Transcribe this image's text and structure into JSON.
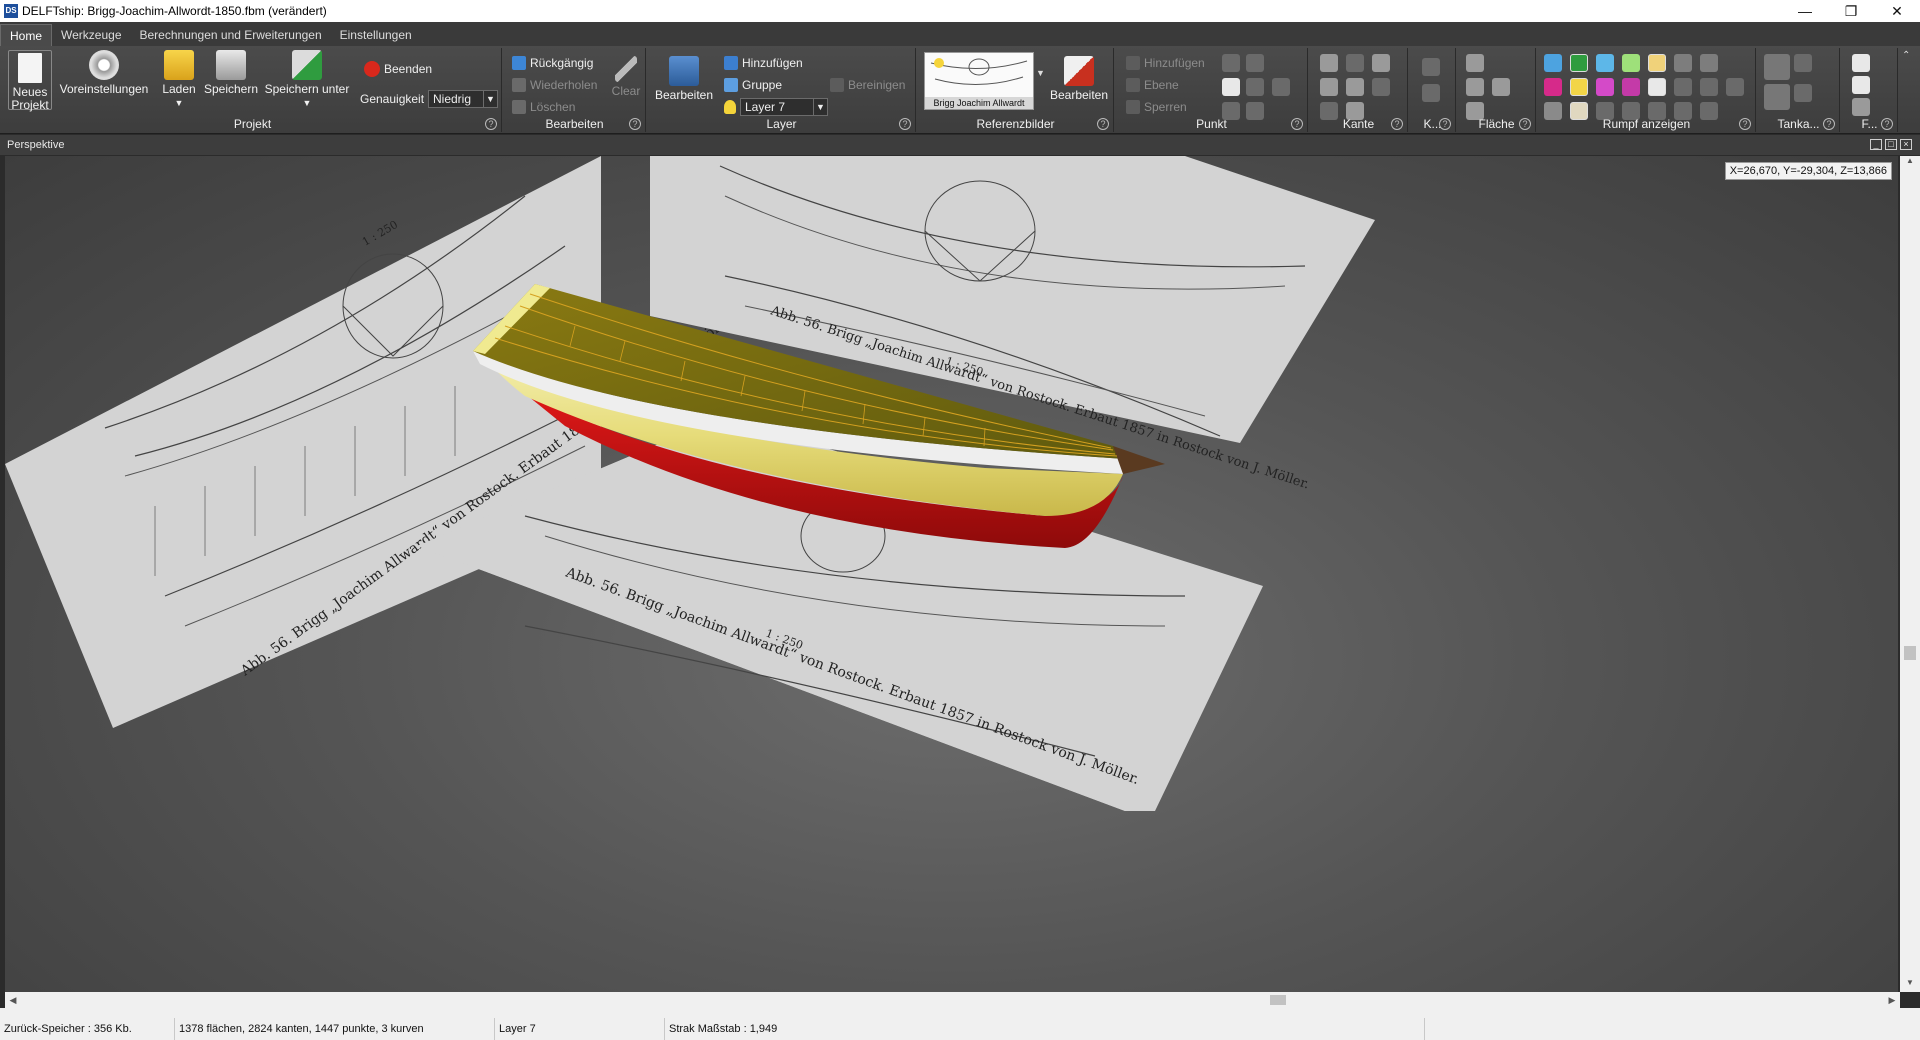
{
  "window": {
    "app_icon": "DS",
    "title": "DELFTship: Brigg-Joachim-Allwordt-1850.fbm (verändert)",
    "minimize_icon": "minimize-icon",
    "maximize_icon": "restore-icon",
    "close_icon": "close-icon"
  },
  "tabs": [
    "Home",
    "Werkzeuge",
    "Berechnungen und Erweiterungen",
    "Einstellungen"
  ],
  "ribbon": {
    "project": {
      "label": "Projekt",
      "new_project": "Neues Projekt",
      "preferences": "Voreinstellungen",
      "load": "Laden",
      "save": "Speichern",
      "save_as": "Speichern unter",
      "quit": "Beenden",
      "precision_label": "Genauigkeit",
      "precision_value": "Niedrig"
    },
    "edit": {
      "label": "Bearbeiten",
      "undo": "Rückgängig",
      "redo": "Wiederholen",
      "delete": "Löschen",
      "clear": "Clear"
    },
    "layer": {
      "label": "Layer",
      "edit": "Bearbeiten",
      "add": "Hinzufügen",
      "group": "Gruppe",
      "current": "Layer 7",
      "cleanup": "Bereinigen"
    },
    "reference": {
      "label": "Referenzbilder",
      "thumb_caption": "Brigg Joachim Allwardt",
      "edit": "Bearbeiten"
    },
    "point": {
      "label": "Punkt",
      "add": "Hinzufügen",
      "plane": "Ebene",
      "lock": "Sperren"
    },
    "edge_label": "Kante",
    "curve_label": "K...",
    "face_label": "Fläche",
    "hull_label": "Rumpf anzeigen",
    "tank_label": "Tanka...",
    "f_label": "F..."
  },
  "viewport": {
    "title": "Perspektive",
    "coords": "X=26,670, Y=-29,304, Z=13,866",
    "drawing_caption": "Abb. 56. Brigg „Joachim Allwardt“ von Rostock. Erbaut 1857 in Rostock von J. Möller.",
    "scale_text": "1 : 250"
  },
  "status": {
    "undo_memory": "Zurück-Speicher : 356 Kb.",
    "counts": "1378 flächen, 2824 kanten, 1447 punkte, 3 kurven",
    "layer": "Layer 7",
    "fairness": "Strak Maßstab : 1,949"
  }
}
